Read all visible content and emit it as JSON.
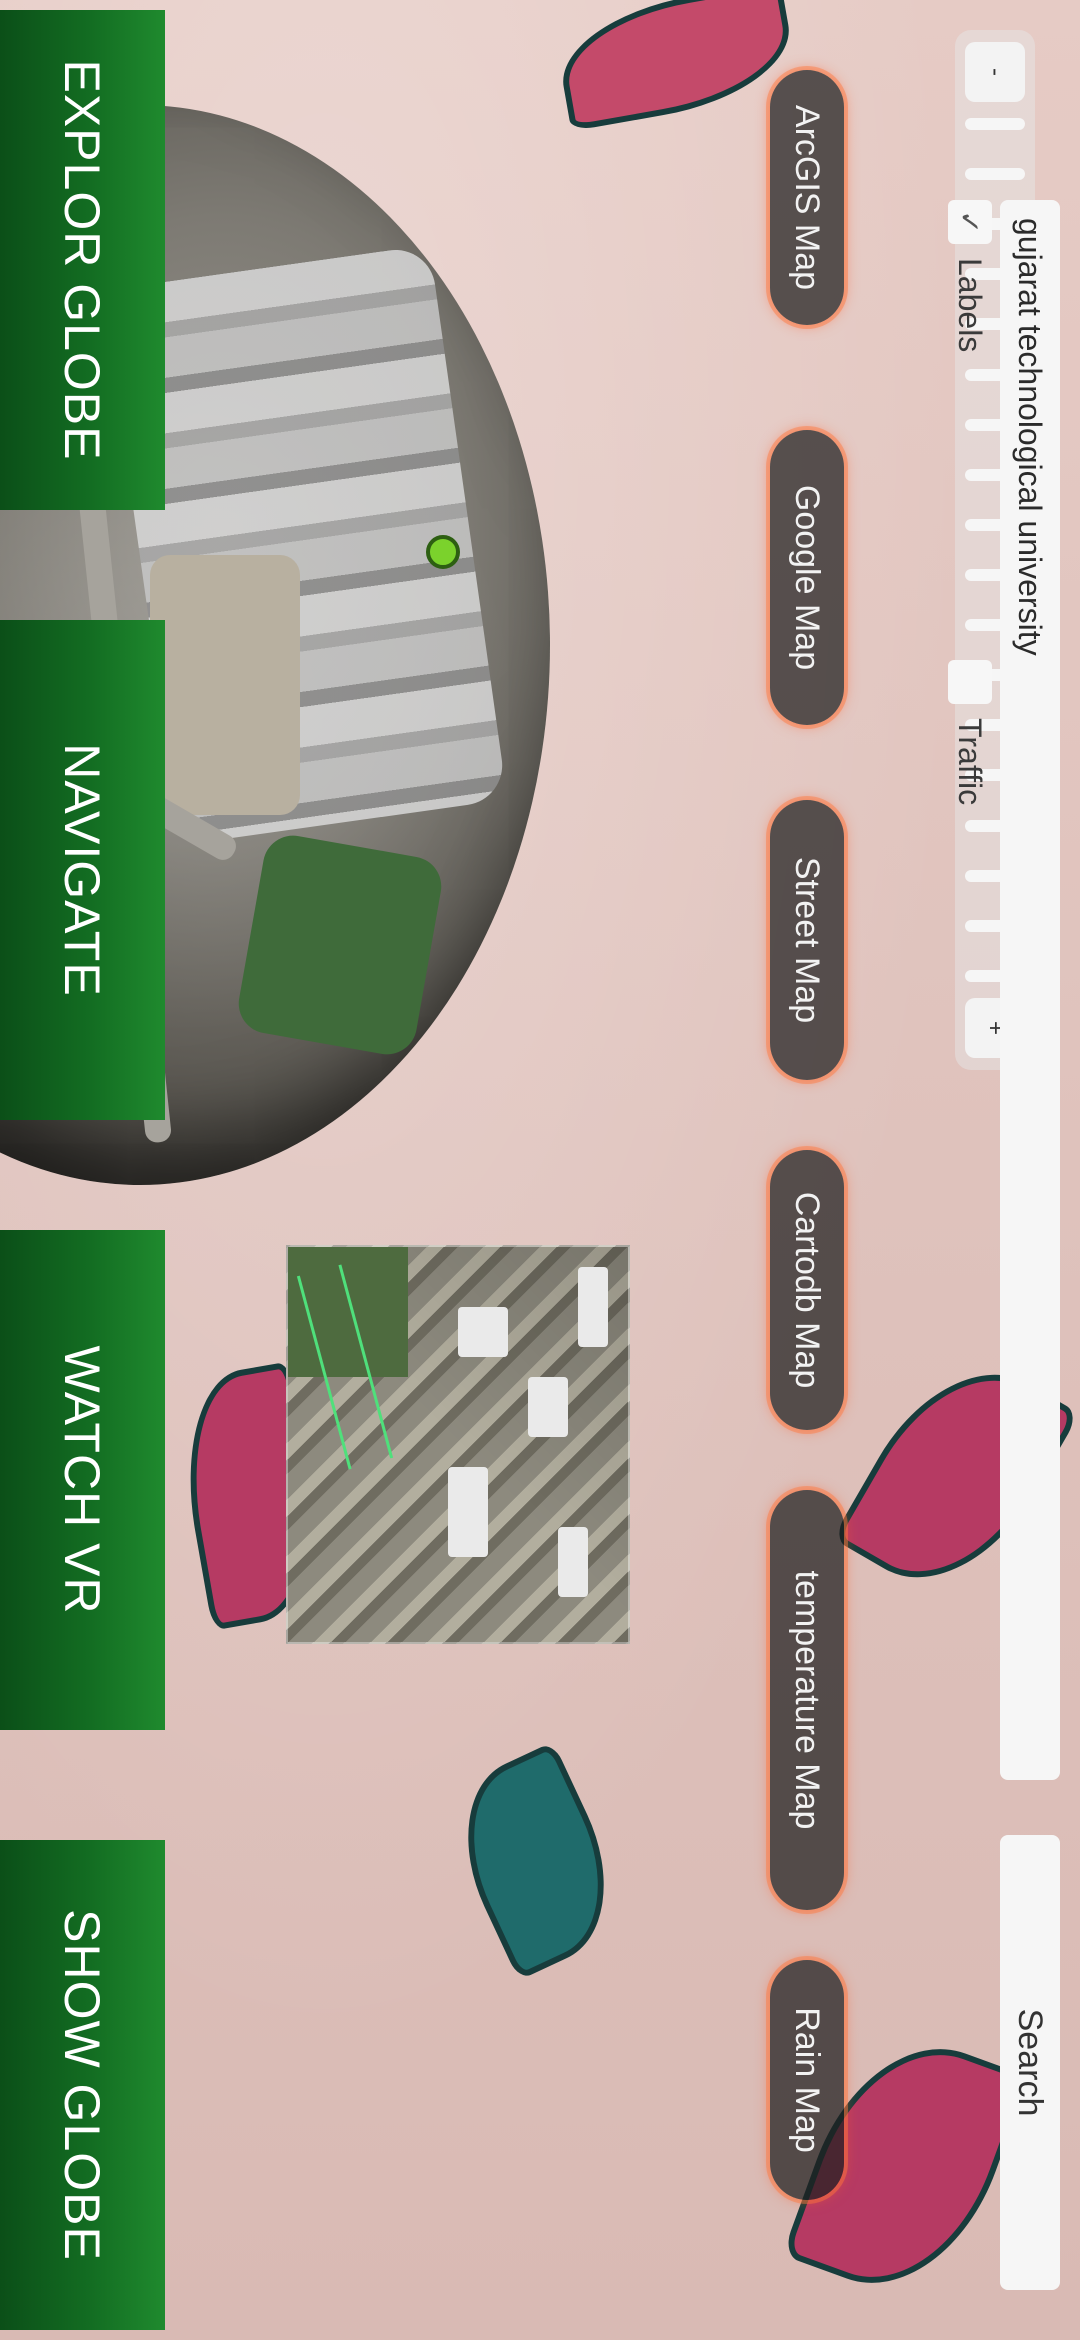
{
  "zoom": {
    "minus_label": "-",
    "plus_label": "+",
    "tick_count": 18
  },
  "search": {
    "value": "gujarat technological university",
    "button_label": "Search"
  },
  "options": {
    "labels": {
      "label": "Labels",
      "checked": true
    },
    "traffic": {
      "label": "Traffic",
      "checked": false
    }
  },
  "map_types": [
    {
      "label": "ArcGIS Map"
    },
    {
      "label": "Google Map"
    },
    {
      "label": "Street Map"
    },
    {
      "label": "Cartodb Map"
    },
    {
      "label": "temperature Map"
    },
    {
      "label": "Rain Map"
    }
  ],
  "actions": [
    {
      "label": "EXPLOR GLOBE"
    },
    {
      "label": "NAVIGATE"
    },
    {
      "label": "WATCH VR"
    },
    {
      "label": "SHOW GLOBE"
    }
  ],
  "icons": {
    "check": "check-icon"
  },
  "colors": {
    "action_green": "#136d22",
    "pill_glow": "#ff6a3a",
    "pin_green": "#7bd22c"
  }
}
